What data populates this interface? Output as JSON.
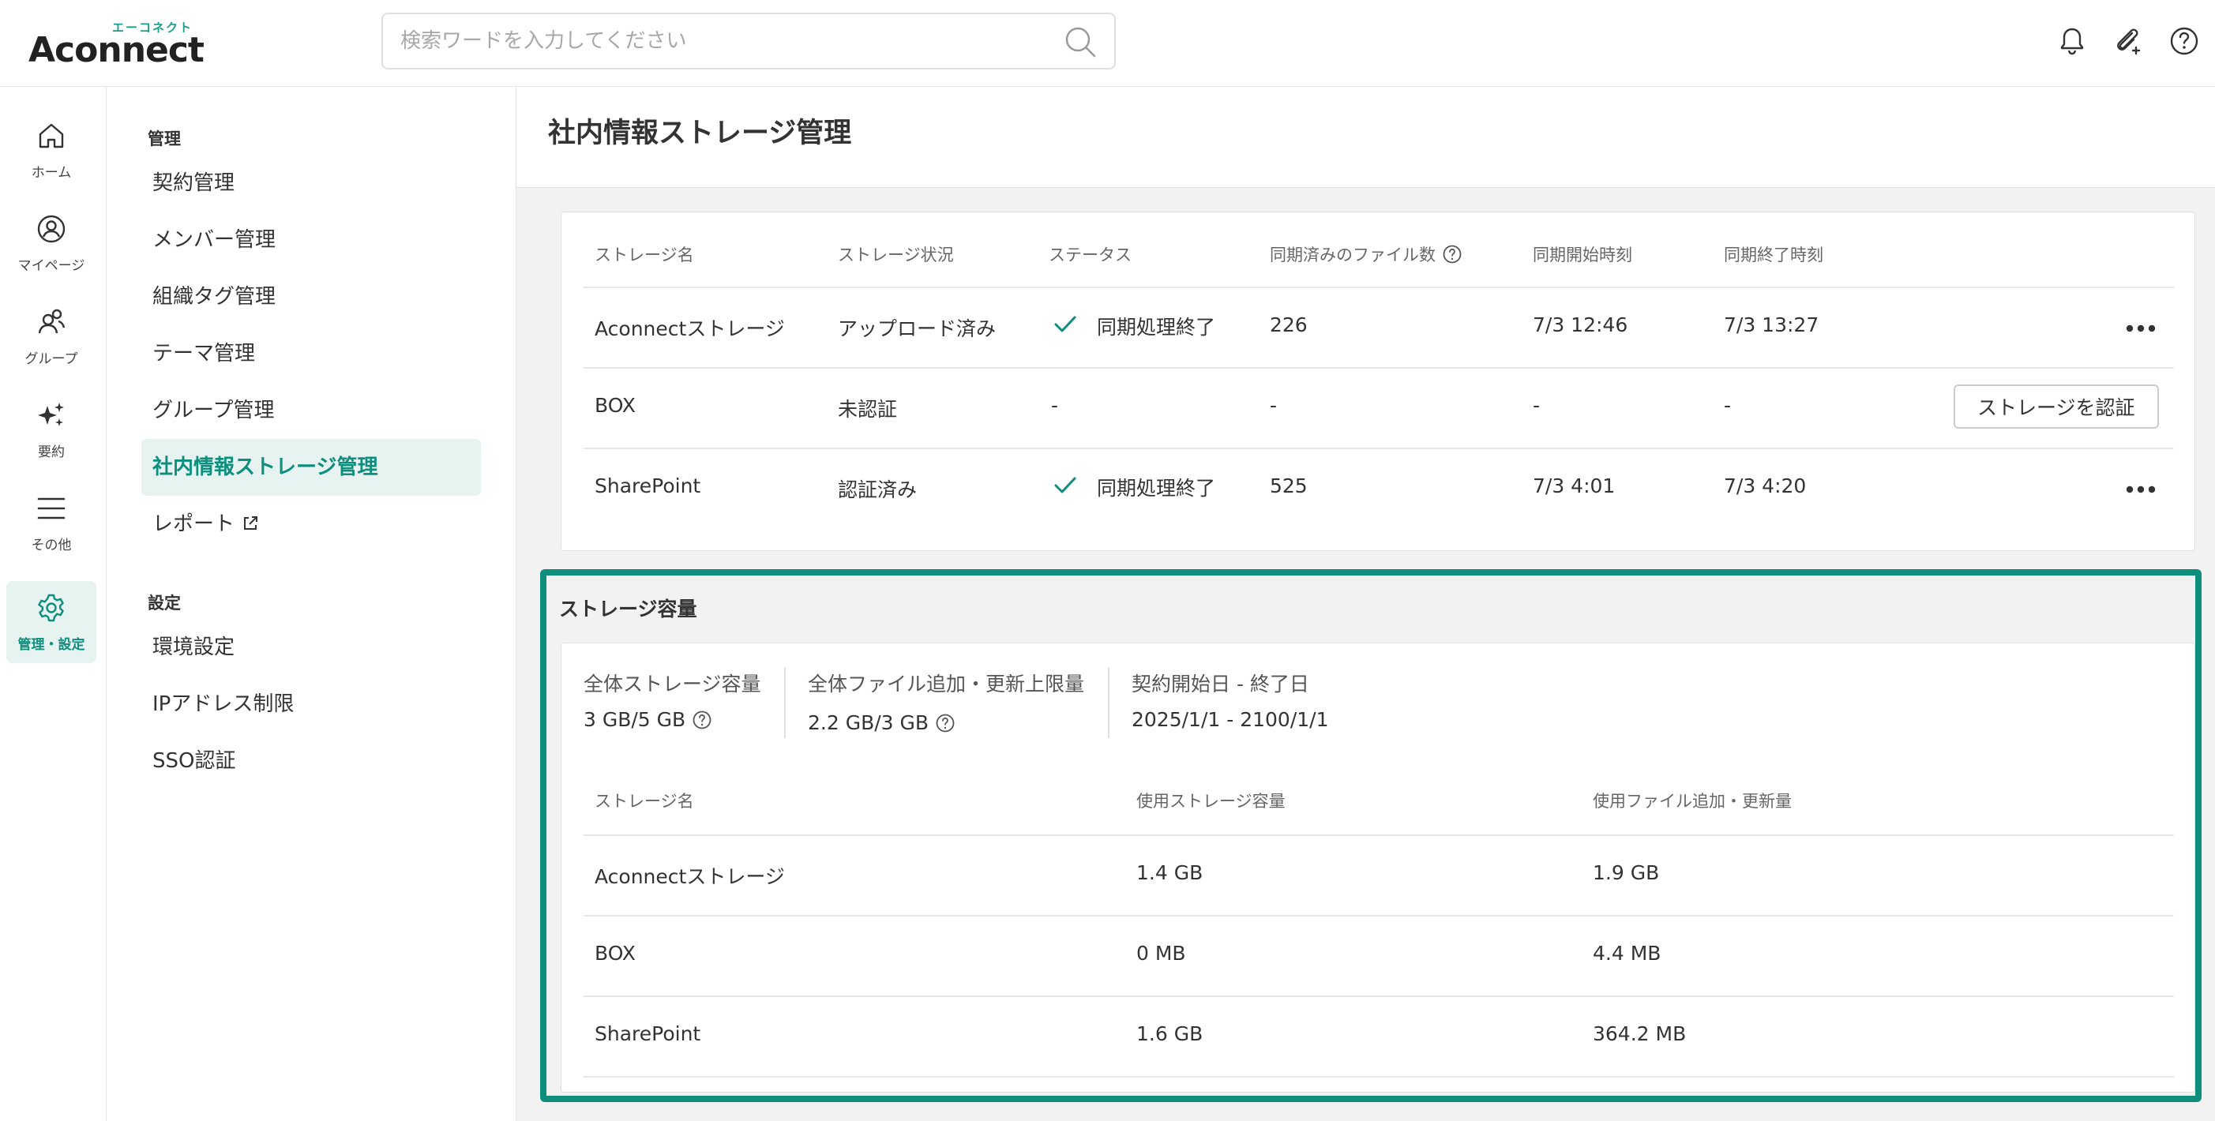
{
  "header": {
    "logo_sub": "エーコネクト",
    "logo_main": "Aconnect",
    "search_placeholder": "検索ワードを入力してください",
    "icons": [
      "bell-icon",
      "attach-icon",
      "help-icon"
    ]
  },
  "rail": [
    {
      "label": "ホーム",
      "icon": "home-icon"
    },
    {
      "label": "マイページ",
      "icon": "user-circle-icon"
    },
    {
      "label": "グループ",
      "icon": "group-icon"
    },
    {
      "label": "要約",
      "icon": "sparkle-icon"
    },
    {
      "label": "その他",
      "icon": "menu-icon"
    },
    {
      "label": "管理・設定",
      "icon": "gear-icon",
      "active": true
    }
  ],
  "submenu": {
    "section1": "管理",
    "items1": [
      "契約管理",
      "メンバー管理",
      "組織タグ管理",
      "テーマ管理",
      "グループ管理",
      "社内情報ストレージ管理",
      "レポート"
    ],
    "section2": "設定",
    "items2": [
      "環境設定",
      "IPアドレス制限",
      "SSO認証"
    ]
  },
  "page": {
    "title": "社内情報ストレージ管理"
  },
  "storage_table": {
    "headers": [
      "ストレージ名",
      "ストレージ状況",
      "ステータス",
      "同期済みのファイル数",
      "同期開始時刻",
      "同期終了時刻"
    ],
    "rows": [
      {
        "name": "Aconnectストレージ",
        "state": "アップロード済み",
        "status": "同期処理終了",
        "files": "226",
        "start": "7/3 12:46",
        "end": "7/3 13:27",
        "action": "more"
      },
      {
        "name": "BOX",
        "state": "未認証",
        "status": "-",
        "files": "-",
        "start": "-",
        "end": "-",
        "action": "ストレージを認証"
      },
      {
        "name": "SharePoint",
        "state": "認証済み",
        "status": "同期処理終了",
        "files": "525",
        "start": "7/3 4:01",
        "end": "7/3 4:20",
        "action": "more"
      }
    ]
  },
  "capacity": {
    "title": "ストレージ容量",
    "summary": [
      {
        "label": "全体ストレージ容量",
        "value": "3 GB/5 GB"
      },
      {
        "label": "全体ファイル追加・更新上限量",
        "value": "2.2 GB/3 GB"
      },
      {
        "label": "契約開始日 - 終了日",
        "value": "2025/1/1 - 2100/1/1"
      }
    ],
    "headers": [
      "ストレージ名",
      "使用ストレージ容量",
      "使用ファイル追加・更新量"
    ],
    "rows": [
      {
        "name": "Aconnectストレージ",
        "used": "1.4 GB",
        "updates": "1.9 GB"
      },
      {
        "name": "BOX",
        "used": "0 MB",
        "updates": "4.4 MB"
      },
      {
        "name": "SharePoint",
        "used": "1.6 GB",
        "updates": "364.2 MB"
      }
    ]
  },
  "colors": {
    "accent": "#0e8f7e",
    "accent_bg": "#e6f3f1"
  }
}
